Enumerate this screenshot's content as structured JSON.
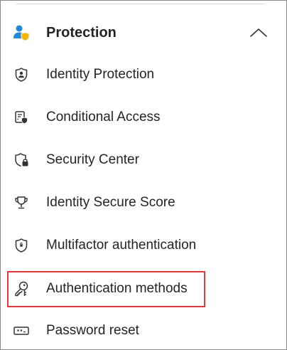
{
  "section": {
    "label": "Protection",
    "icon": "user-shield-icon",
    "expanded": true
  },
  "items": [
    {
      "label": "Identity Protection",
      "icon": "identity-protection-icon"
    },
    {
      "label": "Conditional Access",
      "icon": "conditional-access-icon"
    },
    {
      "label": "Security Center",
      "icon": "security-center-icon"
    },
    {
      "label": "Identity Secure Score",
      "icon": "trophy-icon"
    },
    {
      "label": "Multifactor authentication",
      "icon": "shield-icon"
    },
    {
      "label": "Authentication methods",
      "icon": "key-icon",
      "highlighted": true
    },
    {
      "label": "Password reset",
      "icon": "password-icon"
    }
  ],
  "colors": {
    "highlight": "#e0393e",
    "person_blue": "#1f8bd8",
    "badge_yellow": "#f4b400",
    "text": "#242424"
  }
}
